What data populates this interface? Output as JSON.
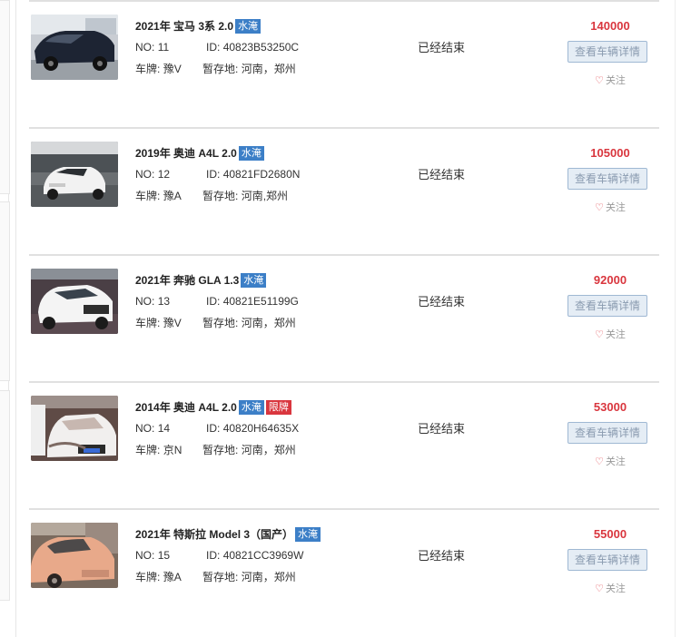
{
  "listings": [
    {
      "title": "2021年 宝马 3系 2.0",
      "tags": [
        {
          "text": "水淹",
          "color": "blue"
        }
      ],
      "no_label": "NO:",
      "no": "11",
      "id_label": "ID:",
      "id": "40823B53250C",
      "plate_label": "车牌:",
      "plate": "豫V",
      "loc_label": "暂存地:",
      "location": "河南，郑州",
      "status": "已经结束",
      "price": "140000",
      "detail_label": "查看车辆详情",
      "follow_label": "关注",
      "image": "black-bmw-sedan"
    },
    {
      "title": "2019年 奥迪 A4L 2.0",
      "tags": [
        {
          "text": "水淹",
          "color": "blue"
        }
      ],
      "no_label": "NO:",
      "no": "12",
      "id_label": "ID:",
      "id": "40821FD2680N",
      "plate_label": "车牌:",
      "plate": "豫A",
      "loc_label": "暂存地:",
      "location": "河南,郑州",
      "status": "已经结束",
      "price": "105000",
      "detail_label": "查看车辆详情",
      "follow_label": "关注",
      "image": "white-audi-sedan"
    },
    {
      "title": "2021年 奔驰 GLA 1.3",
      "tags": [
        {
          "text": "水淹",
          "color": "blue"
        }
      ],
      "no_label": "NO:",
      "no": "13",
      "id_label": "ID:",
      "id": "40821E51199G",
      "plate_label": "车牌:",
      "plate": "豫V",
      "loc_label": "暂存地:",
      "location": "河南，郑州",
      "status": "已经结束",
      "price": "92000",
      "detail_label": "查看车辆详情",
      "follow_label": "关注",
      "image": "white-mercedes-suv"
    },
    {
      "title": "2014年 奥迪 A4L 2.0",
      "tags": [
        {
          "text": "水淹",
          "color": "blue"
        },
        {
          "text": "限牌",
          "color": "red"
        }
      ],
      "no_label": "NO:",
      "no": "14",
      "id_label": "ID:",
      "id": "40820H64635X",
      "plate_label": "车牌:",
      "plate": "京N",
      "loc_label": "暂存地:",
      "location": "河南，郑州",
      "status": "已经结束",
      "price": "53000",
      "detail_label": "查看车辆详情",
      "follow_label": "关注",
      "image": "muddy-white-audi"
    },
    {
      "title": "2021年 特斯拉 Model 3（国产）",
      "tags": [
        {
          "text": "水淹",
          "color": "blue"
        }
      ],
      "no_label": "NO:",
      "no": "15",
      "id_label": "ID:",
      "id": "40821CC3969W",
      "plate_label": "车牌:",
      "plate": "豫A",
      "loc_label": "暂存地:",
      "location": "河南，郑州",
      "status": "已经结束",
      "price": "55000",
      "detail_label": "查看车辆详情",
      "follow_label": "关注",
      "image": "pink-tesla-model3"
    }
  ],
  "colors": {
    "price": "#d9363e",
    "tag_blue": "#3c7fc7",
    "tag_red": "#d9363e",
    "button_bg": "#e5edf5",
    "button_border": "#9fb8d3"
  },
  "icons": {
    "follow": "heart-outline-icon"
  }
}
